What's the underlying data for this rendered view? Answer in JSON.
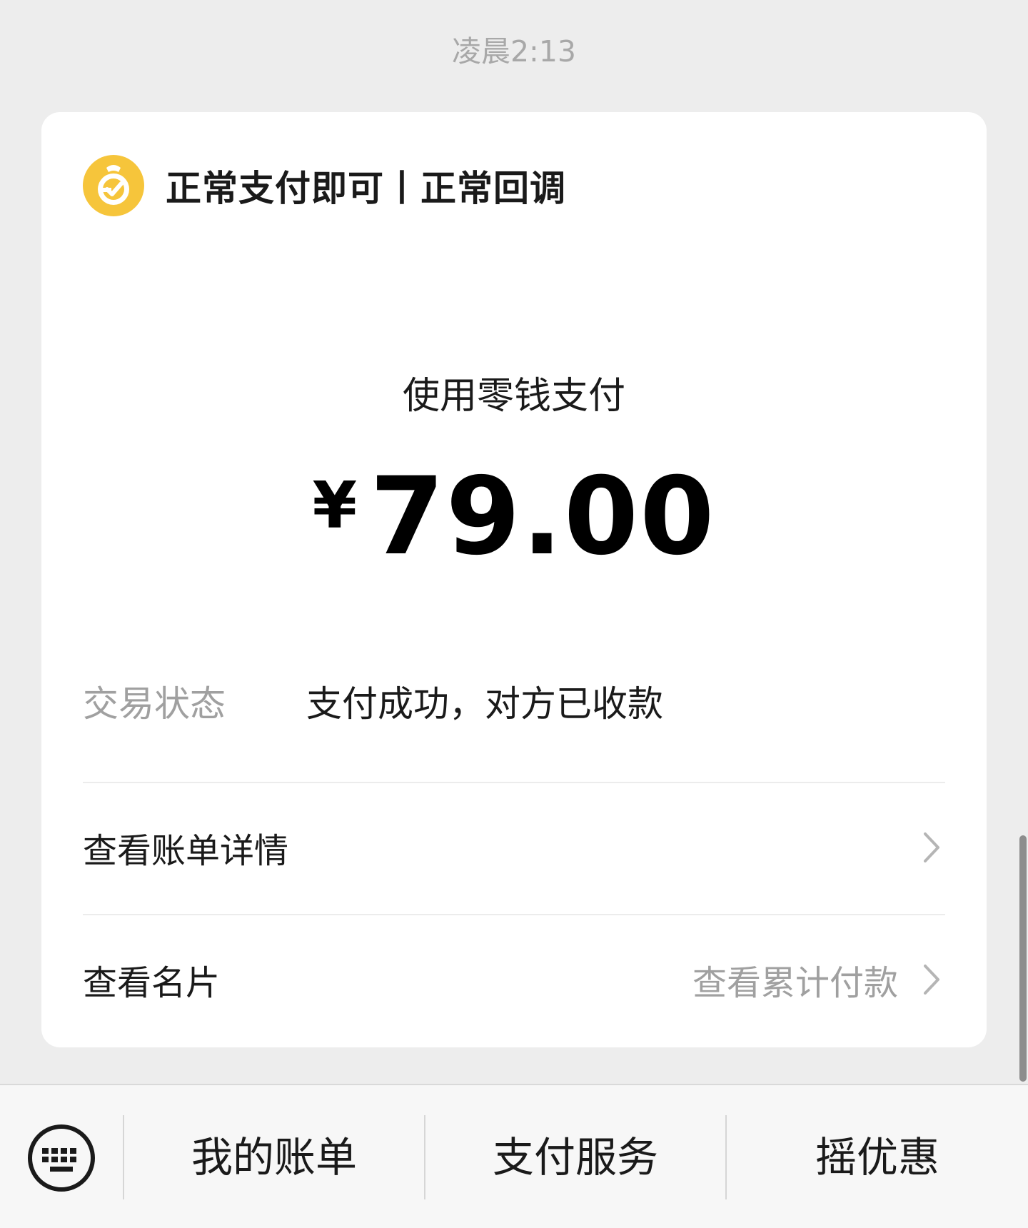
{
  "timestamp": "凌晨2:13",
  "card": {
    "merchant": {
      "logo_icon": "wechat-pay-money-bag-icon",
      "name": "正常支付即可丨正常回调"
    },
    "payment_method": "使用零钱支付",
    "amount": {
      "currency": "¥",
      "value": "79.00"
    },
    "status": {
      "label": "交易状态",
      "value": "支付成功，对方已收款"
    },
    "rows": [
      {
        "label": "查看账单详情",
        "right_text": ""
      },
      {
        "label": "查看名片",
        "right_text": "查看累计付款"
      }
    ]
  },
  "bottom_menu": {
    "keyboard_icon": "keyboard-icon",
    "items": [
      "我的账单",
      "支付服务",
      "摇优惠"
    ]
  },
  "colors": {
    "background": "#ededed",
    "card": "#ffffff",
    "logo": "#f6c53b",
    "secondary_text": "#a0a0a0"
  }
}
